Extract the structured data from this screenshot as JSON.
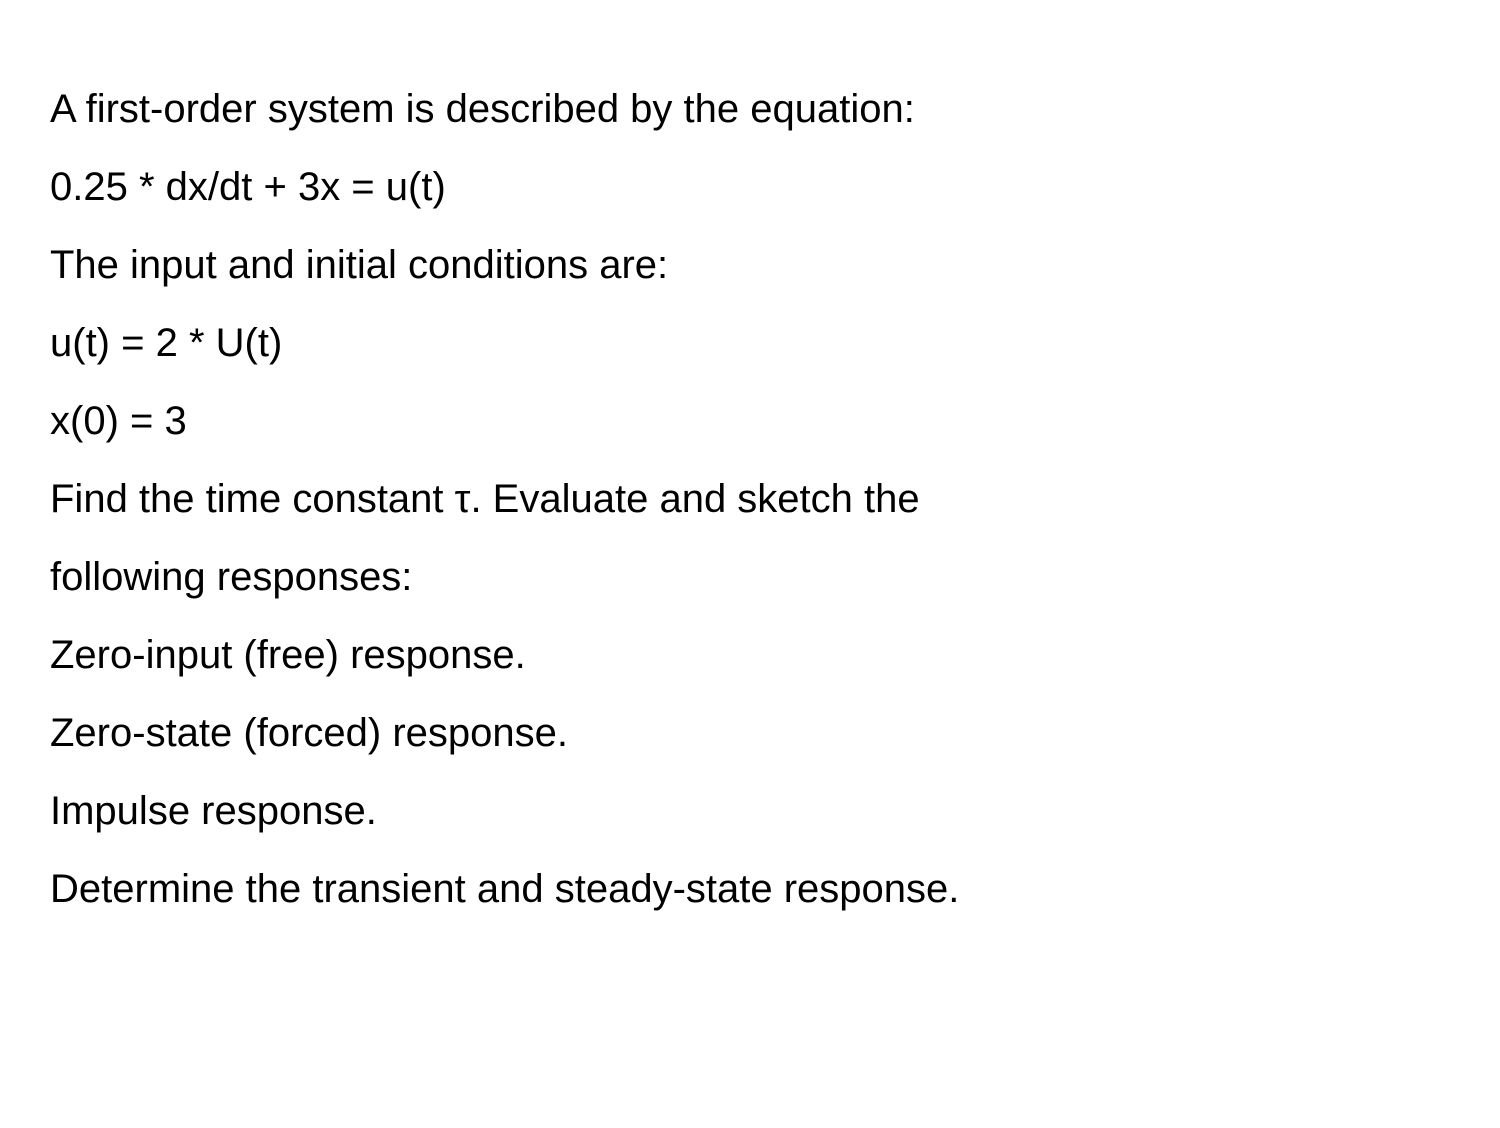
{
  "lines": [
    "A first-order system is described by the equation:",
    "0.25 * dx/dt + 3x = u(t)",
    "The input and initial conditions are:",
    "u(t) = 2 * U(t)",
    "x(0) = 3",
    "Find the time constant τ. Evaluate and sketch the",
    "following responses:",
    "Zero-input (free) response.",
    "Zero-state (forced) response.",
    "Impulse response.",
    "Determine the transient and steady-state response."
  ]
}
